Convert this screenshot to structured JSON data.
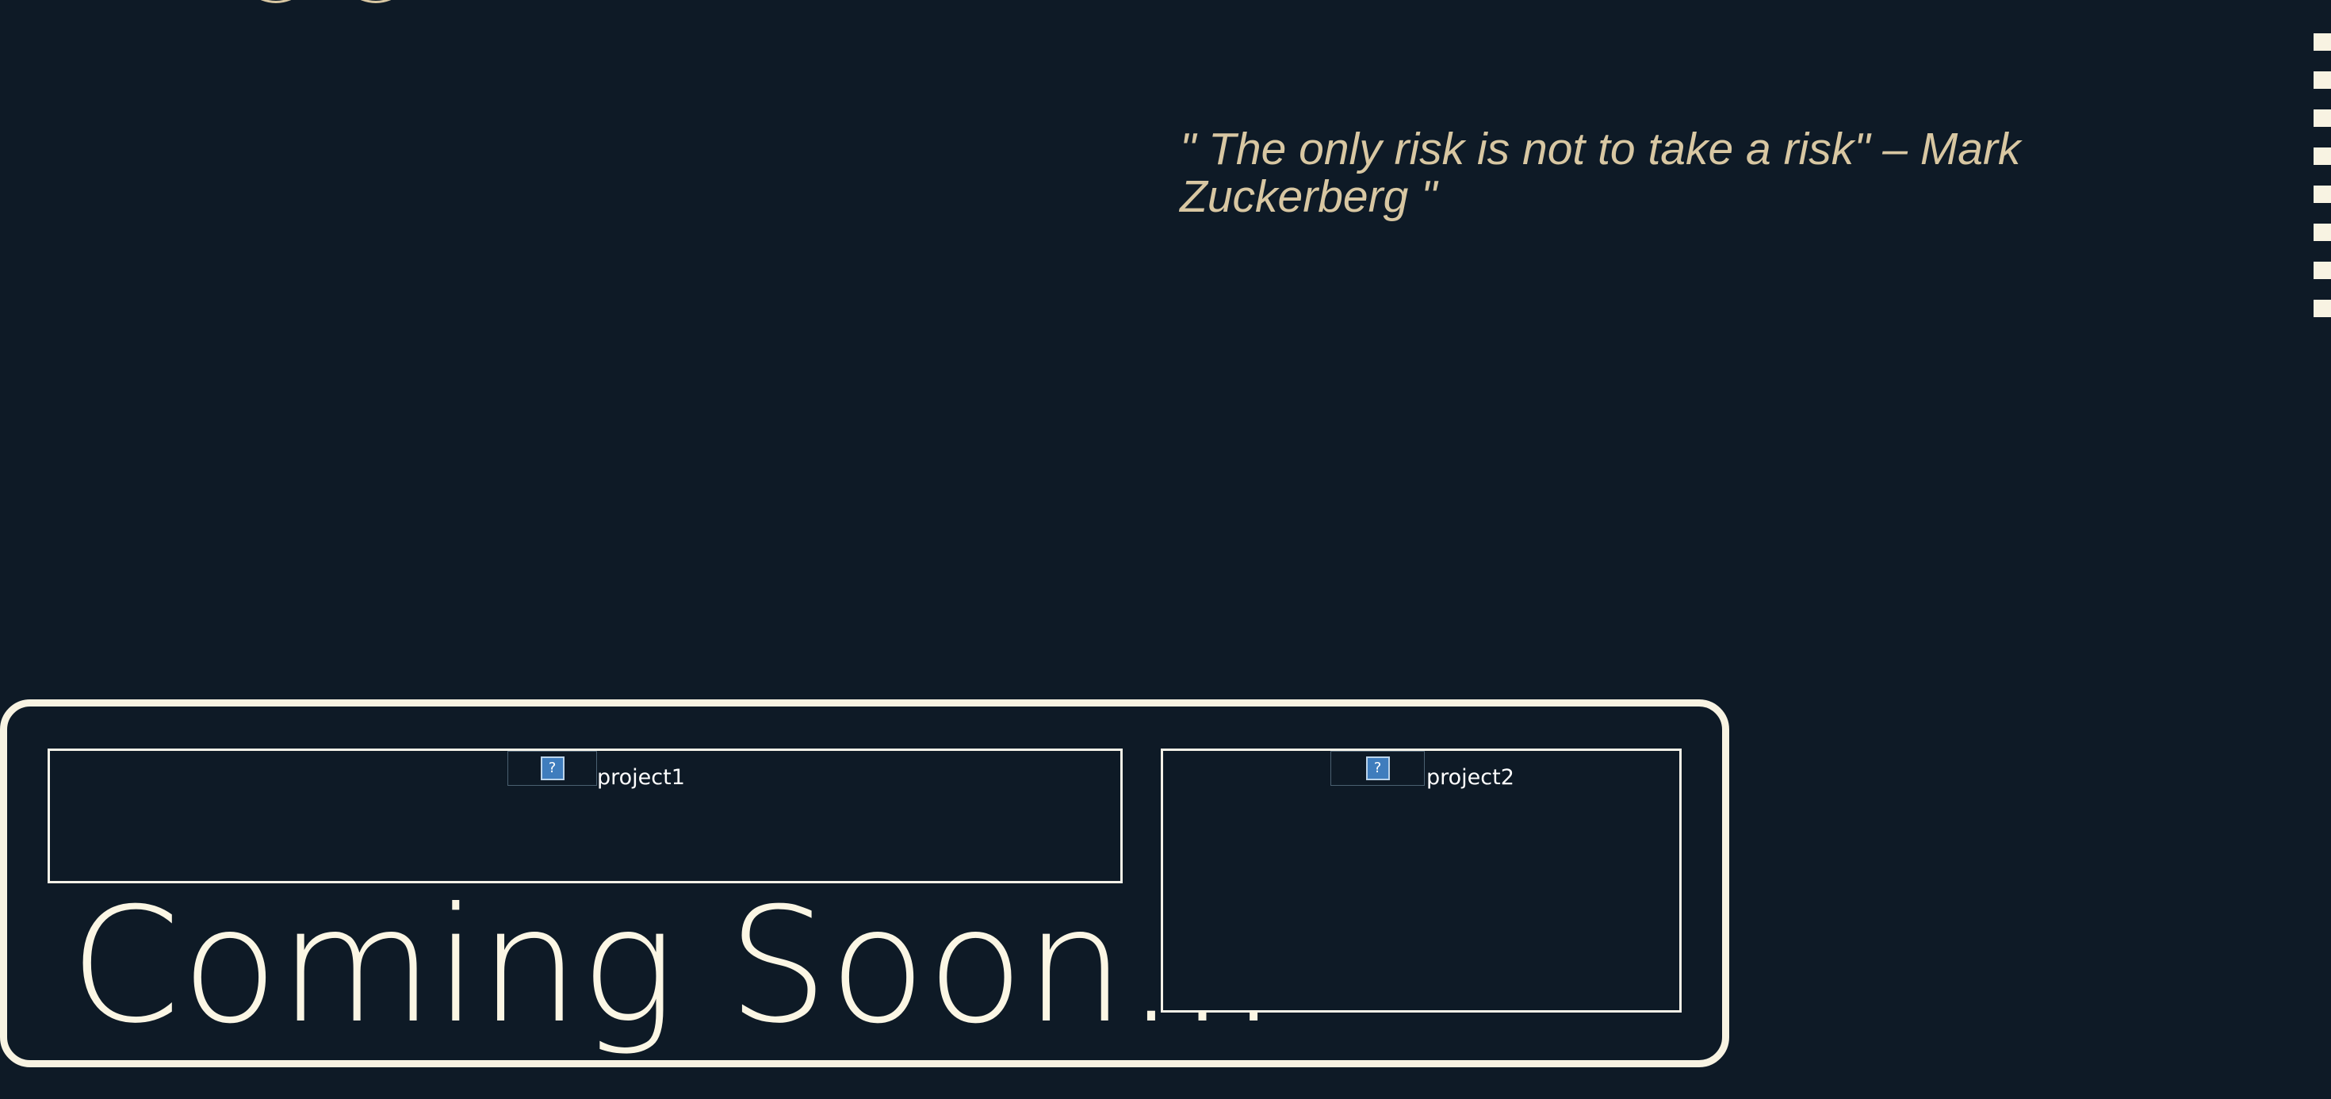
{
  "quote": {
    "text": "\" The only risk is not to take a risk\" – Mark Zuckerberg \""
  },
  "projects": {
    "items": [
      {
        "label": "project1",
        "image_icon": "broken-image-icon"
      },
      {
        "label": "project2",
        "image_icon": "broken-image-icon"
      }
    ],
    "coming_soon": "Coming Soon..."
  },
  "colors": {
    "background": "#0e1a26",
    "quote_text": "#d8c7a2",
    "outline": "#f8f3e2"
  }
}
